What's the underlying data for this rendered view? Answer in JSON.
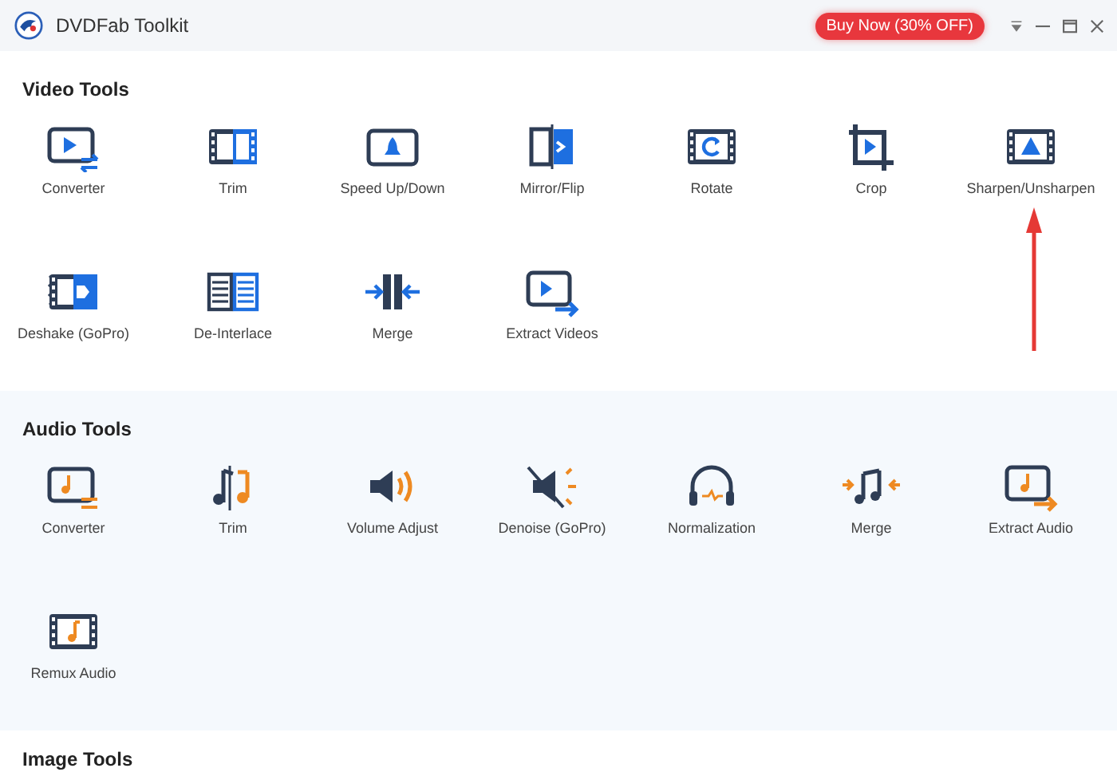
{
  "window": {
    "title": "DVDFab Toolkit",
    "promo_button": "Buy Now (30% OFF)"
  },
  "sections": [
    {
      "title": "Video Tools",
      "tools": [
        {
          "label": "Converter"
        },
        {
          "label": "Trim"
        },
        {
          "label": "Speed Up/Down"
        },
        {
          "label": "Mirror/Flip"
        },
        {
          "label": "Rotate"
        },
        {
          "label": "Crop"
        },
        {
          "label": "Sharpen/Unsharpen"
        },
        {
          "label": "Deshake (GoPro)"
        },
        {
          "label": "De-Interlace"
        },
        {
          "label": "Merge"
        },
        {
          "label": "Extract Videos"
        }
      ]
    },
    {
      "title": "Audio Tools",
      "tools": [
        {
          "label": "Converter"
        },
        {
          "label": "Trim"
        },
        {
          "label": "Volume Adjust"
        },
        {
          "label": "Denoise (GoPro)"
        },
        {
          "label": "Normalization"
        },
        {
          "label": "Merge"
        },
        {
          "label": "Extract Audio"
        },
        {
          "label": "Remux Audio"
        }
      ]
    },
    {
      "title": "Image Tools"
    }
  ]
}
